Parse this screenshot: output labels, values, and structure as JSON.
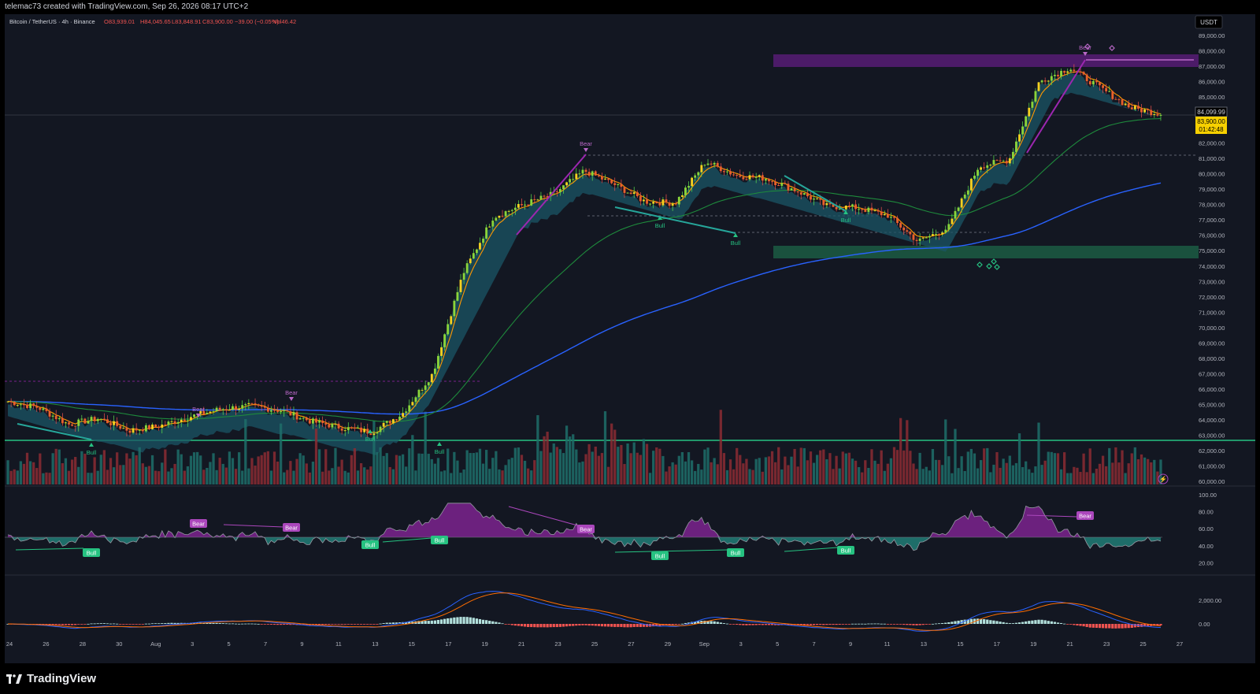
{
  "header": {
    "credit": "telemac73 created with TradingView.com, Sep 26, 2026 08:17 UTC+2"
  },
  "legend": {
    "symbol": "Bitcoin / TetherUS · 4h · Binance",
    "open": "O83,939.01",
    "high": "H84,045.65",
    "low": "L83,848.91",
    "close": "C83,900.00",
    "change": "−39.00 (−0.05%)",
    "volume": "Vol46.42"
  },
  "price_axis": {
    "currency": "USDT",
    "labels": [
      "89,000.00",
      "88,000.00",
      "87,000.00",
      "86,000.00",
      "85,000.00",
      "82,000.00",
      "81,000.00",
      "80,000.00",
      "79,000.00",
      "78,000.00",
      "77,000.00",
      "76,000.00",
      "75,000.00",
      "74,000.00",
      "73,000.00",
      "72,000.00",
      "71,000.00",
      "70,000.00",
      "69,000.00",
      "68,000.00",
      "67,000.00",
      "66,000.00",
      "65,000.00",
      "64,000.00",
      "63,000.00",
      "62,000.00",
      "61,000.00",
      "60,000.00"
    ],
    "last_price_tag": "84,099.99",
    "close_price_tag": "83,900.00",
    "countdown": "01:42:48"
  },
  "rsi_axis": {
    "labels": [
      "100.00",
      "80.00",
      "60.00",
      "40.00",
      "20.00"
    ]
  },
  "macd_axis": {
    "labels": [
      "2,000.00",
      "0.00"
    ]
  },
  "time_axis": {
    "labels": [
      "24",
      "26",
      "28",
      "30",
      "Aug",
      "3",
      "5",
      "7",
      "9",
      "11",
      "13",
      "15",
      "17",
      "19",
      "21",
      "23",
      "25",
      "27",
      "29",
      "Sep",
      "3",
      "5",
      "7",
      "9",
      "11",
      "13",
      "15",
      "17",
      "19",
      "21",
      "23",
      "25",
      "27"
    ]
  },
  "signals": {
    "bull": "Bull",
    "bear": "Bear"
  },
  "footer": {
    "brand": "TradingView"
  },
  "colors": {
    "up": "#26a69a",
    "down": "#ef5350",
    "bg": "#131722",
    "purple": "#9c27b0",
    "green": "#26c281",
    "blue": "#2962ff",
    "orange": "#ff9800",
    "cloud": "#1b5566",
    "yellow": "#f7d000"
  },
  "chart_data": {
    "type": "line",
    "ylim": [
      60000,
      89500
    ],
    "x": [
      "Jul 24",
      "Jul 26",
      "Jul 28",
      "Jul 30",
      "Aug 1",
      "Aug 3",
      "Aug 5",
      "Aug 7",
      "Aug 9",
      "Aug 11",
      "Aug 13",
      "Aug 15",
      "Aug 17",
      "Aug 19",
      "Aug 20",
      "Aug 21",
      "Aug 22",
      "Aug 23",
      "Aug 24",
      "Aug 25",
      "Aug 27",
      "Aug 29",
      "Sep 1",
      "Sep 3",
      "Sep 5",
      "Sep 7",
      "Sep 9",
      "Sep 11",
      "Sep 13",
      "Sep 15",
      "Sep 16",
      "Sep 17",
      "Sep 18",
      "Sep 19",
      "Sep 21",
      "Sep 22",
      "Sep 23",
      "Sep 25",
      "Sep 26"
    ],
    "series": [
      {
        "values": [
          65200,
          64800,
          63700,
          64100,
          63300,
          63600,
          64200,
          64700,
          64900,
          64600,
          63900,
          63500,
          63200,
          64400,
          67000,
          73500,
          77200,
          78000,
          78700,
          80200,
          79300,
          78200,
          78100,
          80800,
          79900,
          79700,
          78900,
          77900,
          77800,
          77300,
          75600,
          76500,
          80500,
          80900,
          86000,
          86900,
          85600,
          84300,
          83900
        ]
      }
    ],
    "key_levels": [
      63000,
      75000,
      87300,
      81200,
      77500,
      66700
    ]
  }
}
